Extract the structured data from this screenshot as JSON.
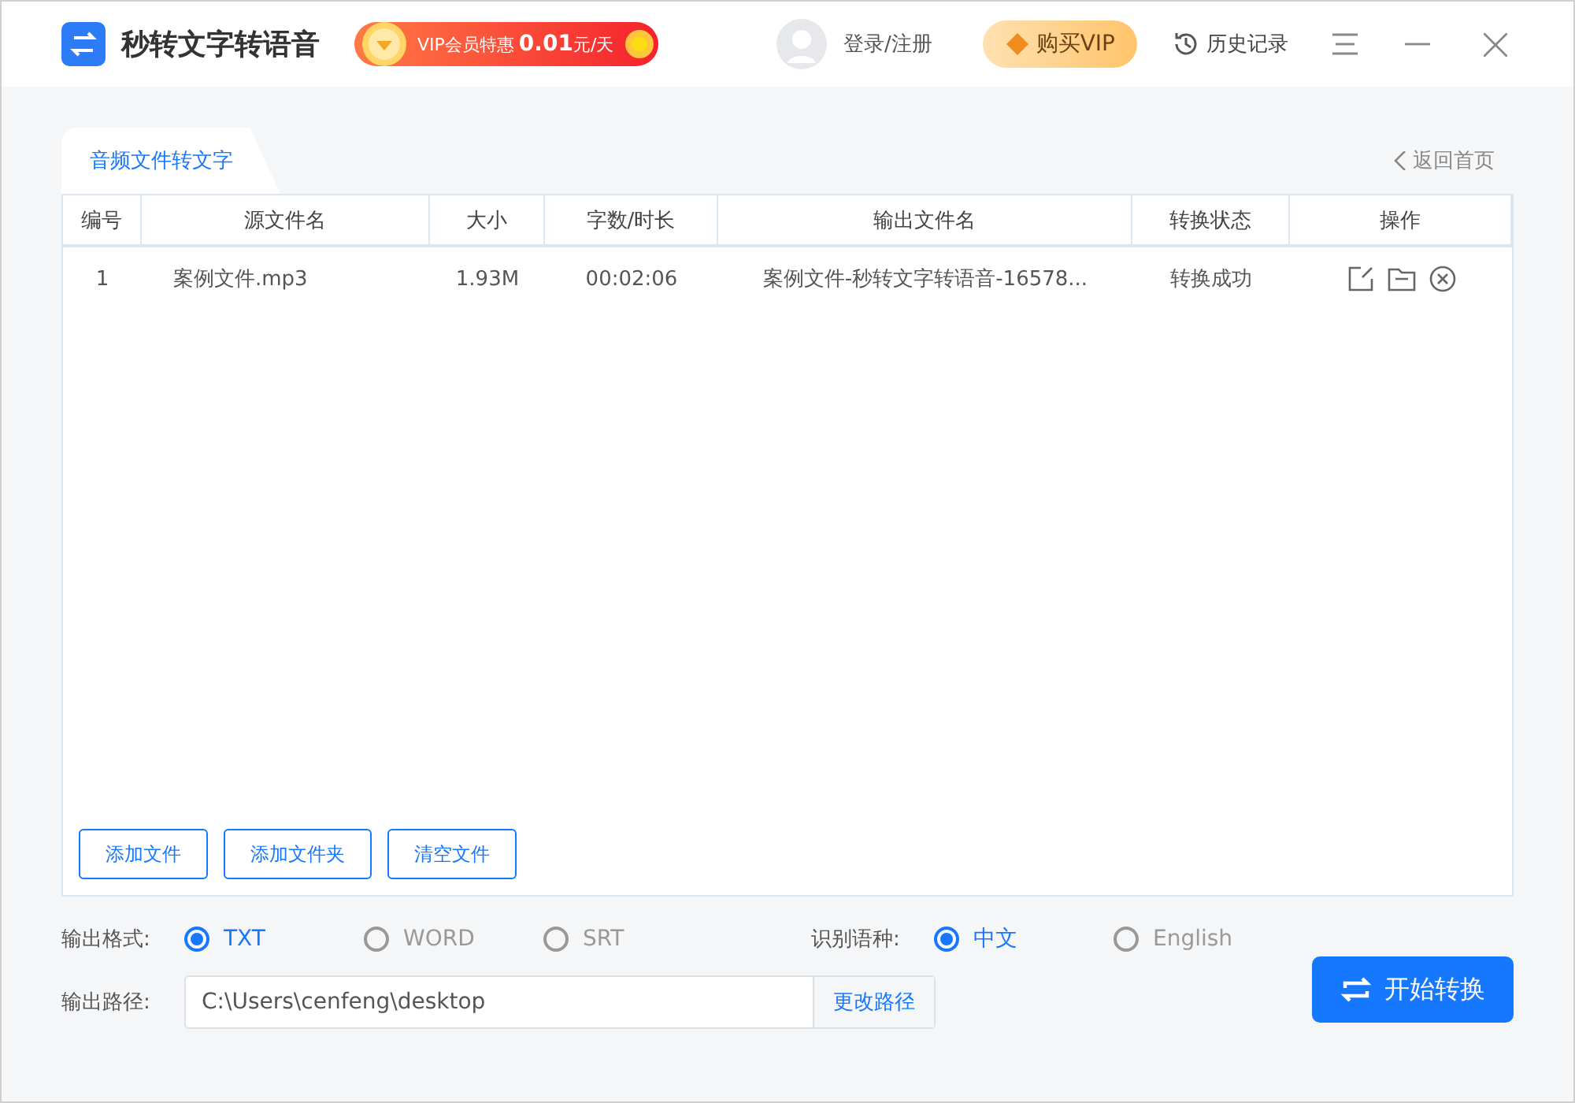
{
  "app": {
    "title": "秒转文字转语音",
    "promo": {
      "label": "VIP会员特惠",
      "price": "0.01",
      "unit": "元/天"
    }
  },
  "header": {
    "login": "登录/注册",
    "buy_vip": "购买VIP",
    "history": "历史记录"
  },
  "tabs": [
    {
      "label": "音频文件转文字",
      "selected": true
    }
  ],
  "back": "返回首页",
  "table": {
    "columns": [
      "编号",
      "源文件名",
      "大小",
      "字数/时长",
      "输出文件名",
      "转换状态",
      "操作"
    ],
    "rows": [
      {
        "index": "1",
        "source": "案例文件.mp3",
        "size": "1.93M",
        "duration": "00:02:06",
        "output": "案例文件-秒转文字转语音-16578...",
        "status": "转换成功"
      }
    ]
  },
  "file_buttons": [
    "添加文件",
    "添加文件夹",
    "清空文件"
  ],
  "format": {
    "label": "输出格式:",
    "options": [
      {
        "label": "TXT",
        "selected": true
      },
      {
        "label": "WORD",
        "selected": false
      },
      {
        "label": "SRT",
        "selected": false
      }
    ]
  },
  "language": {
    "label": "识别语种:",
    "options": [
      {
        "label": "中文",
        "selected": true
      },
      {
        "label": "English",
        "selected": false
      }
    ]
  },
  "path": {
    "label": "输出路径:",
    "value": "C:\\Users\\cenfeng\\desktop",
    "button": "更改路径"
  },
  "start_button": "开始转换"
}
